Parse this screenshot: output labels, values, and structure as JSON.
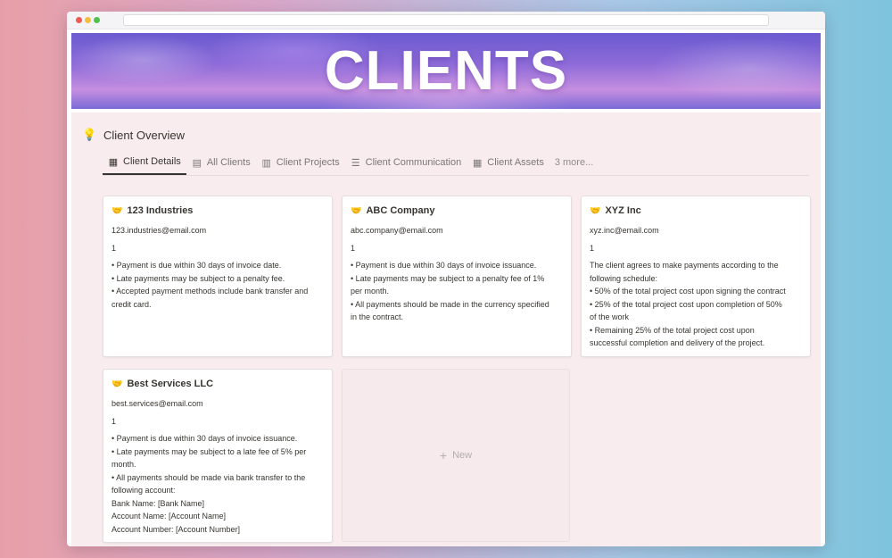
{
  "banner": {
    "title": "CLIENTS"
  },
  "overview": {
    "icon": "lightbulb-icon",
    "title": "Client Overview"
  },
  "tabs": [
    {
      "label": "Client Details",
      "icon": "gallery-icon",
      "active": true
    },
    {
      "label": "All Clients",
      "icon": "table-icon",
      "active": false
    },
    {
      "label": "Client Projects",
      "icon": "board-icon",
      "active": false
    },
    {
      "label": "Client Communication",
      "icon": "list-icon",
      "active": false
    },
    {
      "label": "Client Assets",
      "icon": "gallery-icon",
      "active": false
    }
  ],
  "more_tabs": "3 more...",
  "cards": [
    {
      "icon": "handshake-icon",
      "name": "123 Industries",
      "email": "123.industries@email.com",
      "number": "1",
      "terms": [
        "• Payment is due within 30 days of invoice date.",
        "• Late payments may be subject to a penalty fee.",
        "• Accepted payment methods include bank transfer and",
        "credit card."
      ]
    },
    {
      "icon": "handshake-icon",
      "name": "ABC Company",
      "email": "abc.company@email.com",
      "number": "1",
      "terms": [
        "• Payment is due within 30 days of invoice issuance.",
        "• Late payments may be subject to a penalty fee of 1%",
        "per month.",
        "• All payments should be made in the currency specified",
        "in the contract."
      ]
    },
    {
      "icon": "handshake-icon",
      "name": "XYZ Inc",
      "email": "xyz.inc@email.com",
      "number": "1",
      "terms": [
        "The client agrees to make payments according to the",
        "following schedule:",
        "• 50% of the total project cost upon signing the contract",
        "• 25% of the total project cost upon completion of 50%",
        "of the work",
        "• Remaining 25% of the total project cost upon",
        "successful completion and delivery of the project."
      ]
    },
    {
      "icon": "handshake-icon",
      "name": "Best Services LLC",
      "email": "best.services@email.com",
      "number": "1",
      "terms": [
        "• Payment is due within 30 days of invoice issuance.",
        "• Late payments may be subject to a late fee of 5% per",
        "month.",
        "• All payments should be made via bank transfer to the",
        "following account:",
        "Bank Name: [Bank Name]",
        "Account Name: [Account Name]",
        "Account Number: [Account Number]"
      ]
    }
  ],
  "new_card": {
    "label": "New",
    "icon": "plus-icon"
  }
}
